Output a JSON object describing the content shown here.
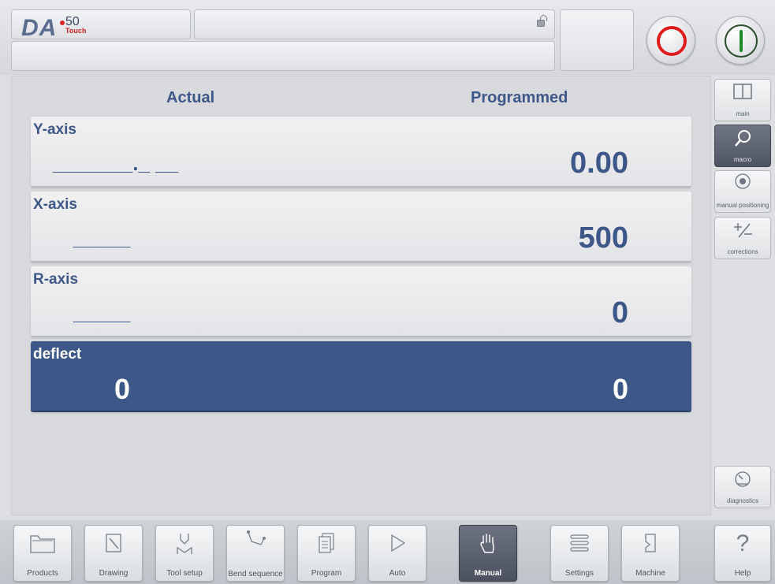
{
  "header": {
    "logo_text": "DA",
    "logo_model": "50",
    "logo_sub": "Touch"
  },
  "columns": {
    "actual": "Actual",
    "programmed": "Programmed"
  },
  "axes": [
    {
      "name": "Y-axis",
      "actual": "_______._ __",
      "programmed": "0.00"
    },
    {
      "name": "X-axis",
      "actual": "_____",
      "programmed": "500"
    },
    {
      "name": "R-axis",
      "actual": "_____",
      "programmed": "0"
    }
  ],
  "deflect": {
    "name": "deflect",
    "actual": "0",
    "programmed": "0"
  },
  "side_nav": [
    {
      "label": "main",
      "icon": "split-panel-icon"
    },
    {
      "label": "macro",
      "icon": "magnifier-icon",
      "active": true
    },
    {
      "label": "manual positioning",
      "icon": "dial-icon"
    },
    {
      "label": "corrections",
      "icon": "plus-minus-icon"
    },
    {
      "label": "diagnostics",
      "icon": "gauge-icon"
    }
  ],
  "bottom_nav": [
    {
      "label": "Products",
      "icon": "folder-icon"
    },
    {
      "label": "Drawing",
      "icon": "pencil-icon"
    },
    {
      "label": "Tool setup",
      "icon": "tool-icon"
    },
    {
      "label": "Bend sequence",
      "icon": "bend-icon"
    },
    {
      "label": "Program",
      "icon": "document-stack-icon"
    },
    {
      "label": "Auto",
      "icon": "play-icon"
    },
    {
      "label": "Manual",
      "icon": "hand-icon",
      "active": true
    },
    {
      "label": "Settings",
      "icon": "list-icon"
    },
    {
      "label": "Machine",
      "icon": "machine-icon"
    },
    {
      "label": "Help",
      "icon": "question-icon"
    }
  ],
  "colors": {
    "accent": "#3d5788",
    "stop": "#e01b1b",
    "start": "#1f8a2c"
  }
}
